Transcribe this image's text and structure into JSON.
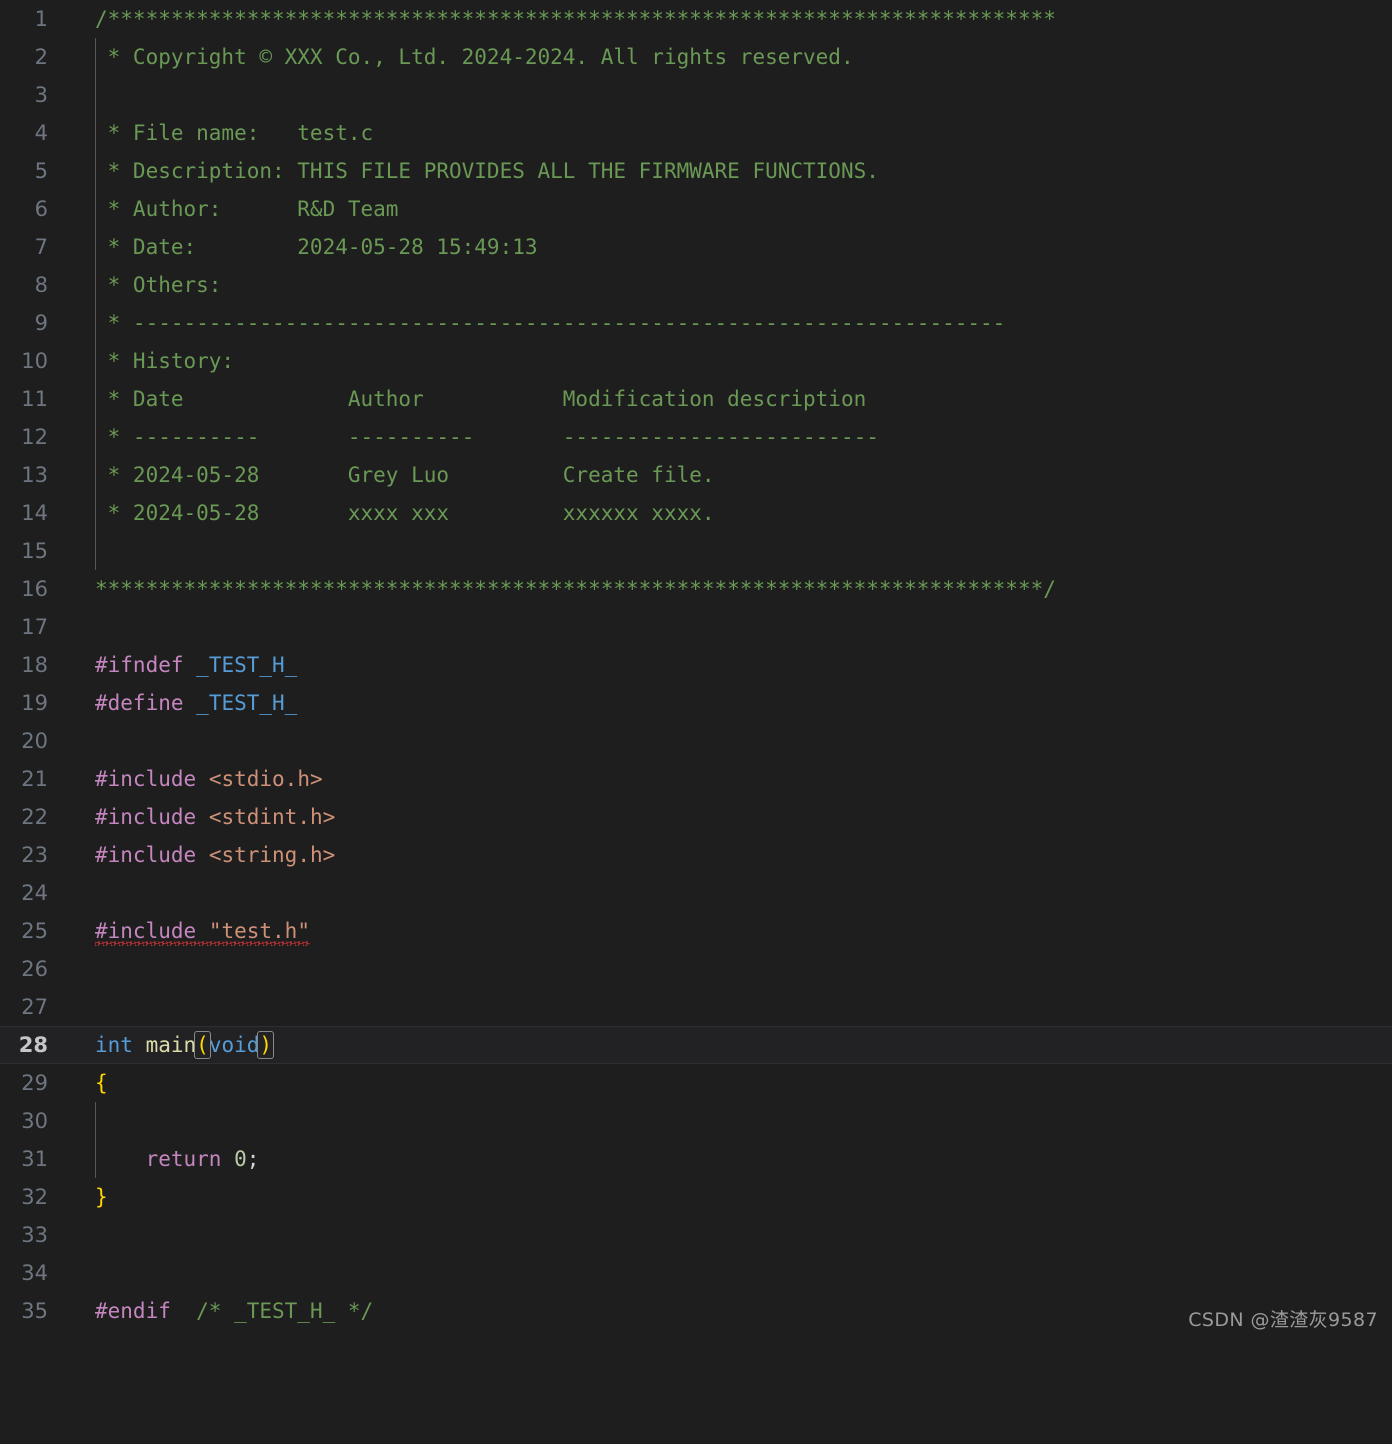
{
  "editor": {
    "theme": "vscode-dark",
    "language": "c",
    "background_color": "#1e1e1e",
    "active_line_background": "#222225",
    "gutter_color": "#6e7681",
    "active_gutter_color": "#c6c6c6",
    "total_lines": 35,
    "active_line_number": 28,
    "error_line_number": 25,
    "colors": {
      "comment": "#6a9955",
      "preprocessor": "#c586c0",
      "macro_name": "#569cd6",
      "keyword": "#569cd6",
      "string": "#ce9178",
      "function": "#dcdcaa",
      "number": "#b5cea8",
      "control": "#c586c0",
      "brace": "#ffd700",
      "punctuation": "#d4d4d4",
      "squiggle": "#d13438",
      "indent_guide": "#58585b",
      "bracket_match_outline": "#888888"
    }
  },
  "line_numbers": [
    "1",
    "2",
    "3",
    "4",
    "5",
    "6",
    "7",
    "8",
    "9",
    "10",
    "11",
    "12",
    "13",
    "14",
    "15",
    "16",
    "17",
    "18",
    "19",
    "20",
    "21",
    "22",
    "23",
    "24",
    "25",
    "26",
    "27",
    "28",
    "29",
    "30",
    "31",
    "32",
    "33",
    "34",
    "35"
  ],
  "code": {
    "line1_banner": "/***************************************************************************",
    "line2_copyright": " * Copyright © XXX Co., Ltd. 2024-2024. All rights reserved.",
    "line3_blank": "",
    "line4_filename": " * File name:   test.c",
    "line5_description": " * Description: THIS FILE PROVIDES ALL THE FIRMWARE FUNCTIONS.",
    "line6_author": " * Author:      R&D Team",
    "line7_date": " * Date:        2024-05-28 15:49:13",
    "line8_others": " * Others:",
    "line9_rule": " * ---------------------------------------------------------------------",
    "line10_history": " * History:",
    "line11_headers": " * Date             Author           Modification description",
    "line12_underline": " * ----------       ----------       -------------------------",
    "line13_entry": " * 2024-05-28       Grey Luo         Create file.",
    "line14_entry": " * 2024-05-28       xxxx xxx         xxxxxx xxxx.",
    "line15_blank": "",
    "line16_banner_end": "***************************************************************************/",
    "line17_blank": "",
    "line18_ifndef_directive": "#ifndef",
    "line18_guard_macro": "_TEST_H_",
    "line19_define_directive": "#define",
    "line19_guard_macro": "_TEST_H_",
    "line20_blank": "",
    "line21_include_directive": "#include",
    "line21_header": "<stdio.h>",
    "line22_include_directive": "#include",
    "line22_header": "<stdint.h>",
    "line23_include_directive": "#include",
    "line23_header": "<string.h>",
    "line24_blank": "",
    "line25_include_directive": "#include",
    "line25_header": "\"test.h\"",
    "line26_blank": "",
    "line27_blank": "",
    "line28_return_type": "int",
    "line28_function_name": "main",
    "line28_paren_open": "(",
    "line28_param": "void",
    "line28_paren_close": ")",
    "line29_brace_open": "{",
    "line30_blank": "",
    "line31_return_keyword": "return",
    "line31_return_value": "0",
    "line31_semicolon": ";",
    "line32_brace_close": "}",
    "line33_blank": "",
    "line34_blank": "",
    "line35_endif_directive": "#endif",
    "line35_trailing_comment": "/* _TEST_H_ */"
  },
  "watermark": {
    "text": "CSDN @渣渣灰9587"
  }
}
